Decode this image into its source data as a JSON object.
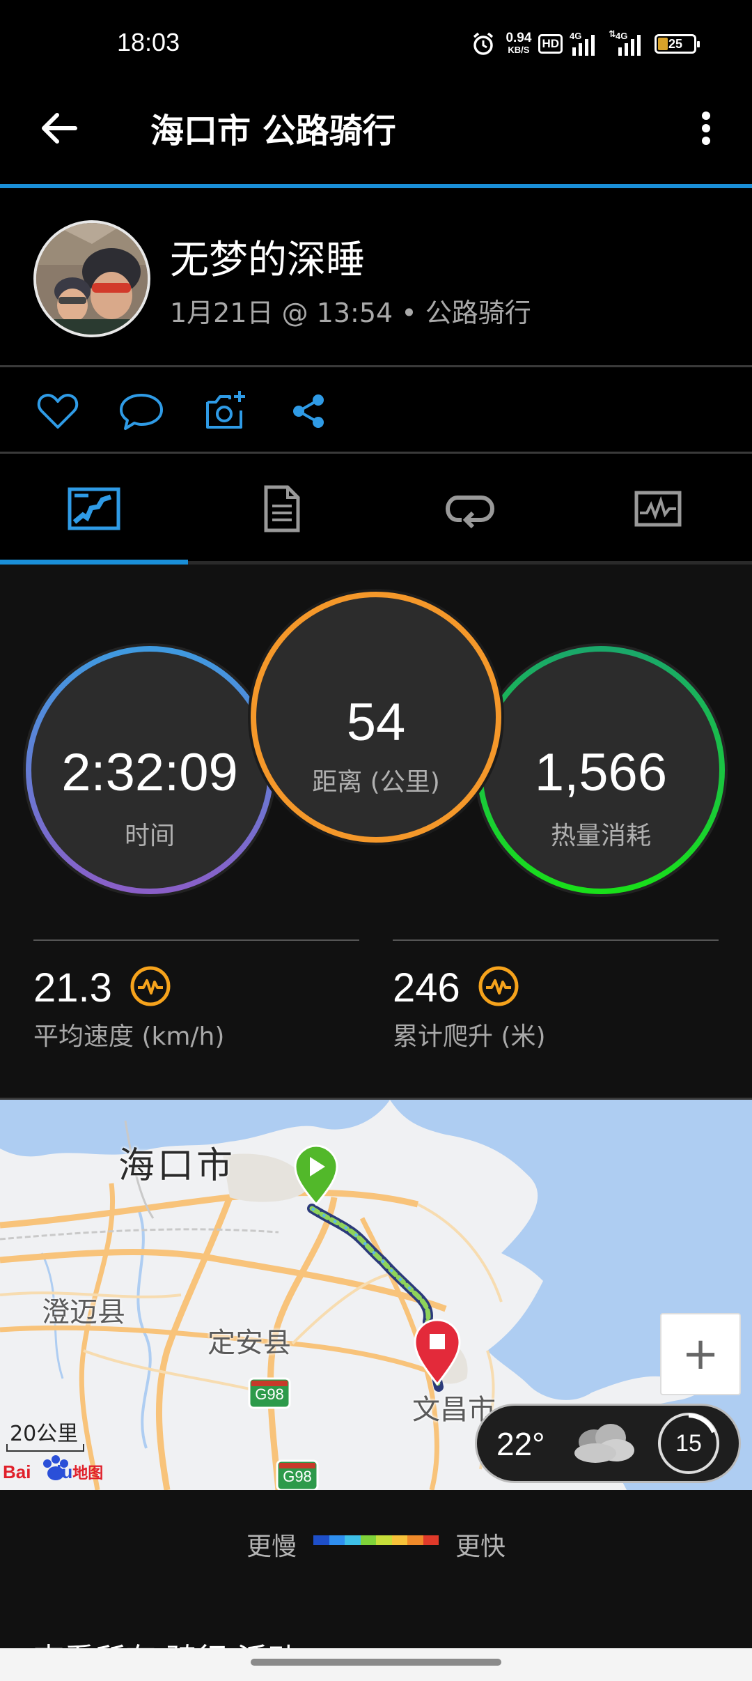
{
  "status_bar": {
    "time": "18:03",
    "net_speed_value": "0.94",
    "net_speed_unit": "KB/S",
    "hd_badge": "HD",
    "signal1_label": "4G",
    "signal2_label": "4G",
    "battery": "25"
  },
  "app_bar": {
    "title": "海口市 公路骑行"
  },
  "profile": {
    "name": "无梦的深睡",
    "subtitle": "1月21日 @ 13:54 • 公路骑行"
  },
  "actions": [
    "heart-icon",
    "comment-icon",
    "add-photo-icon",
    "share-icon"
  ],
  "tabs": [
    "overview-tab",
    "details-tab",
    "laps-tab",
    "charts-tab"
  ],
  "stats": {
    "time": {
      "value": "2:32:09",
      "label": "时间"
    },
    "distance": {
      "value": "54",
      "label": "距离 (公里)"
    },
    "calories": {
      "value": "1,566",
      "label": "热量消耗"
    },
    "avg_speed": {
      "value": "21.3",
      "label": "平均速度 (km/h)"
    },
    "ascent": {
      "value": "246",
      "label": "累计爬升 (米)"
    }
  },
  "map": {
    "city_haikou": "海口市",
    "city_chengmai": "澄迈县",
    "city_dingan": "定安县",
    "city_wenchang": "文昌市",
    "road_g98_1": "G98",
    "road_g98_2": "G98",
    "scale": "20公里",
    "baidu_logo_1": "Bai",
    "baidu_logo_2": "du",
    "baidu_logo_3": "地图",
    "zoom_in": "+",
    "weather_temp": "22°",
    "weather_badge": "15"
  },
  "legend": {
    "slow": "更慢",
    "fast": "更快",
    "colors": [
      "#1e4fc9",
      "#2f8ff0",
      "#3ec0e8",
      "#7fd33a",
      "#c7de3a",
      "#f7c23a",
      "#f08a2a",
      "#e03a2a"
    ]
  },
  "see_all": "查看所有 骑行 活动",
  "colors": {
    "accent": "#1a8fd8",
    "ring_time": "#4a8fd8",
    "ring_distance": "#f39a2a",
    "ring_calories": "#22cc44",
    "effect_icon": "#f6a31c"
  }
}
